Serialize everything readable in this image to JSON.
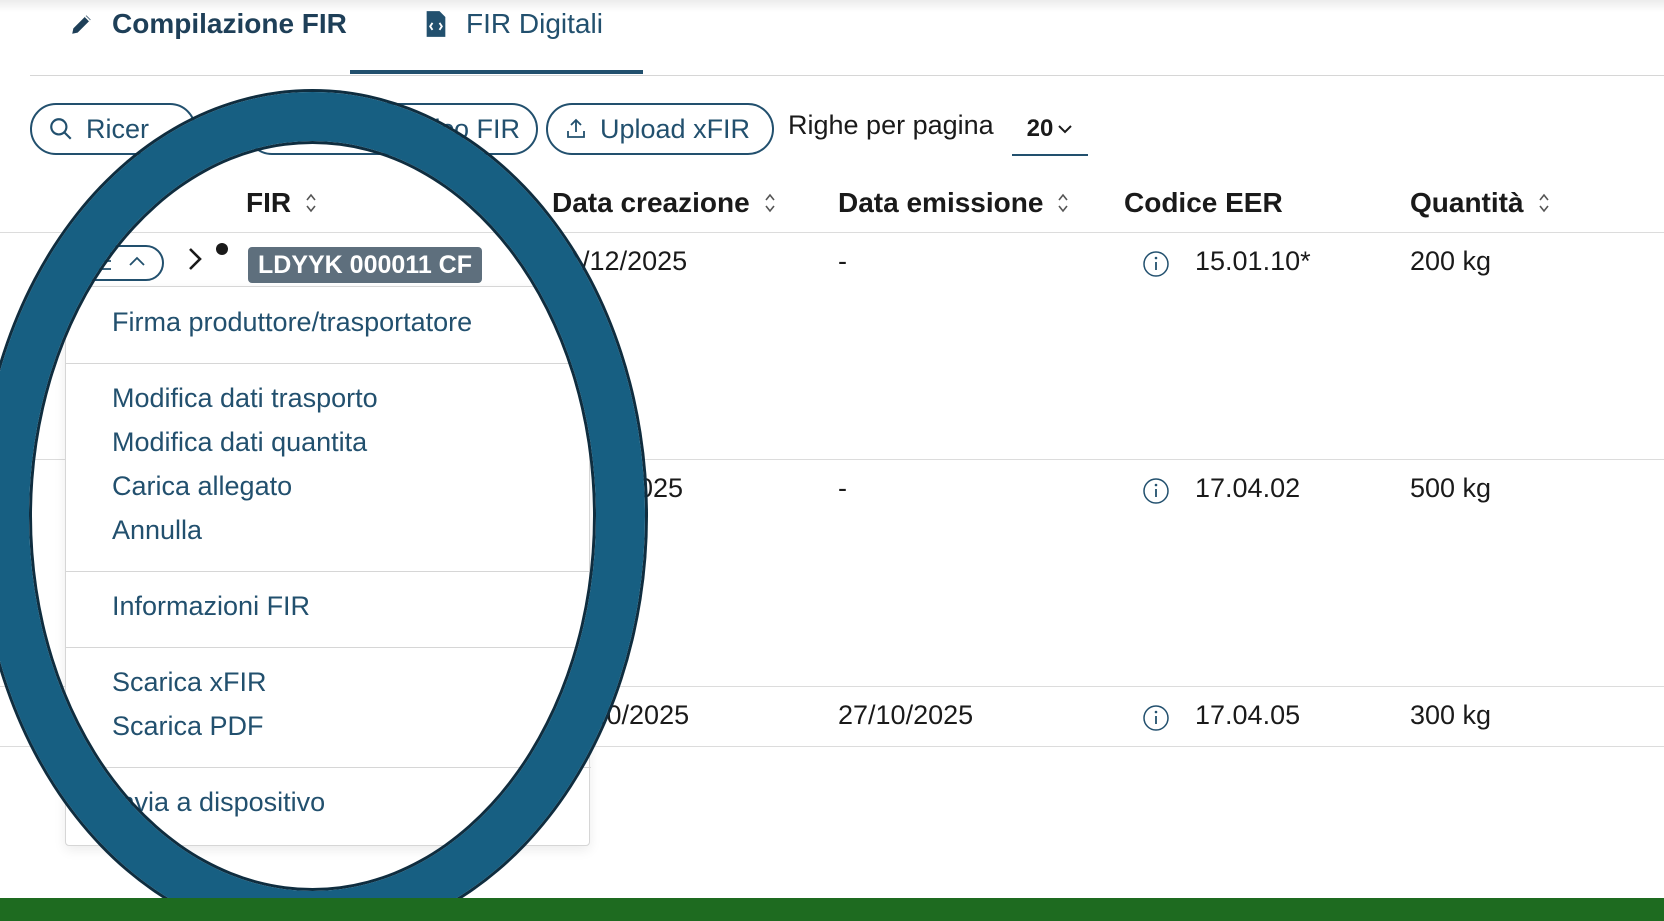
{
  "tabs": [
    {
      "label": "Compilazione FIR",
      "icon": "pencil-icon"
    },
    {
      "label": "FIR Digitali",
      "icon": "code-file-icon",
      "active": true
    }
  ],
  "toolbar": {
    "search_label": "Ricerca",
    "search_visible": "Ricer",
    "scarico_label": "Scarico FIR",
    "scarico_visible": "arico FIR",
    "upload_label": "Upload xFIR",
    "rows_per_page_label": "Righe per pagina",
    "rows_per_page_value": "20"
  },
  "table": {
    "columns": [
      "FIR",
      "Data creazione",
      "Data emissione",
      "Codice EER",
      "Quantità"
    ],
    "rows": [
      {
        "fir": "LDYYK 000011 CF",
        "data_creazione": "01/12/2025",
        "data_emissione": "-",
        "codice_eer": "15.01.10*",
        "quantita": "200 kg"
      },
      {
        "data_creazione_visible": "2025",
        "data_emissione": "-",
        "codice_eer": "17.04.02",
        "quantita": "500 kg"
      },
      {
        "data_creazione_visible": "/10/2025",
        "data_emissione": "27/10/2025",
        "codice_eer": "17.04.05",
        "quantita": "300 kg"
      }
    ]
  },
  "menu": {
    "items": [
      "Firma produttore/trasportatore",
      "Modifica dati trasporto",
      "Modifica dati quantita",
      "Carica allegato",
      "Annulla",
      "Informazioni FIR",
      "Scarica xFIR",
      "Scarica PDF",
      "Invia a dispositivo"
    ]
  },
  "colors": {
    "accent": "#22506e",
    "badge": "#5e6f7d",
    "magnifier": "#175f82",
    "footer": "#1e6b20"
  }
}
